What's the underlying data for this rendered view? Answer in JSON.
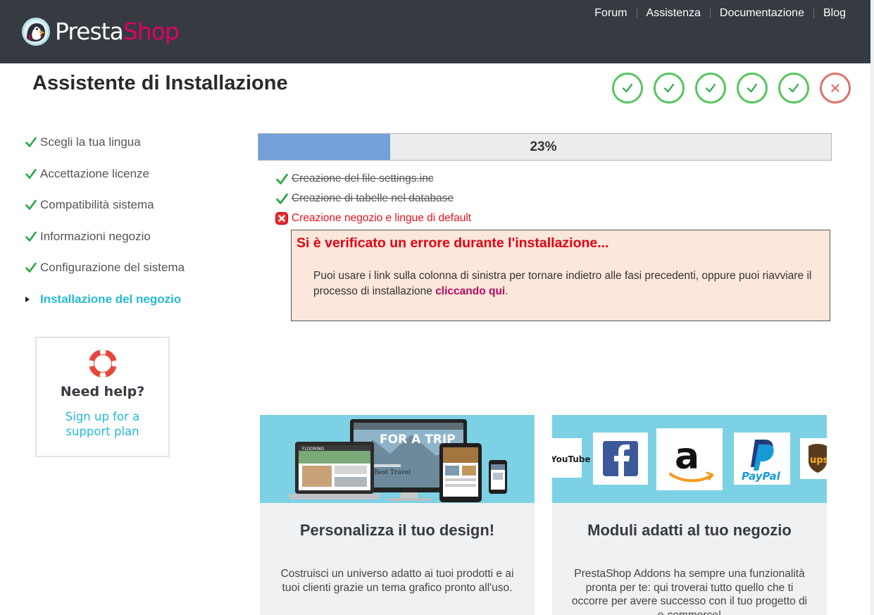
{
  "header": {
    "logo_presta": "Presta",
    "logo_shop": "Shop",
    "nav": [
      "Forum",
      "Assistenza",
      "Documentazione",
      "Blog"
    ]
  },
  "page_title": "Assistente di Installazione",
  "step_indicators": [
    "completed",
    "completed",
    "completed",
    "completed",
    "completed",
    "error"
  ],
  "sidebar": {
    "items": [
      {
        "label": "Scegli la tua lingua",
        "state": "done"
      },
      {
        "label": "Accettazione licenze",
        "state": "done"
      },
      {
        "label": "Compatibilità sistema",
        "state": "done"
      },
      {
        "label": "Informazioni negozio",
        "state": "done"
      },
      {
        "label": "Configurazione del sistema",
        "state": "done"
      },
      {
        "label": "Installazione del negozio",
        "state": "active"
      }
    ],
    "help": {
      "title": "Need help?",
      "link_line1": "Sign up for a",
      "link_line2": "support plan"
    }
  },
  "progress": {
    "percent": 23,
    "label": "23%"
  },
  "tasks": [
    {
      "label": "Creazione del file settings.inc",
      "state": "done"
    },
    {
      "label": "Creazione di tabelle nel database",
      "state": "done"
    },
    {
      "label": "Creazione negozio e lingue di default",
      "state": "error"
    }
  ],
  "error": {
    "title": "Si è verificato un errore durante l'installazione...",
    "message_before": "Puoi usare i link sulla colonna di sinistra per tornare indietro alle fasi precedenti, oppure puoi riavviare il processo di installazione ",
    "link": "cliccando qui",
    "message_after": "."
  },
  "cards": [
    {
      "title": "Personalizza il tuo design!",
      "text": "Costruisci un universo adatto ai tuoi prodotti e ai tuoi clienti grazie un tema grafico pronto all'uso.",
      "image_words": [
        "FLOORING",
        "FOR A TRIP",
        "Best Travel"
      ]
    },
    {
      "title": "Moduli adatti al tuo negozio",
      "text": "PrestaShop Addons ha sempre una funzionalità pronta per te: qui troverai tutto quello che ti occorre per avere successo con il tuo progetto di e-commerce!",
      "image_words": [
        "YouTube",
        "PayPal",
        "ups"
      ]
    }
  ],
  "colors": {
    "header_bg": "#363a41",
    "brand_pink": "#df0067",
    "accent_cyan": "#25b9d7",
    "success_green": "#55c65e",
    "error_red": "#e3131b",
    "progress_fill": "#72a0d8",
    "error_bg": "#fbe7db"
  }
}
